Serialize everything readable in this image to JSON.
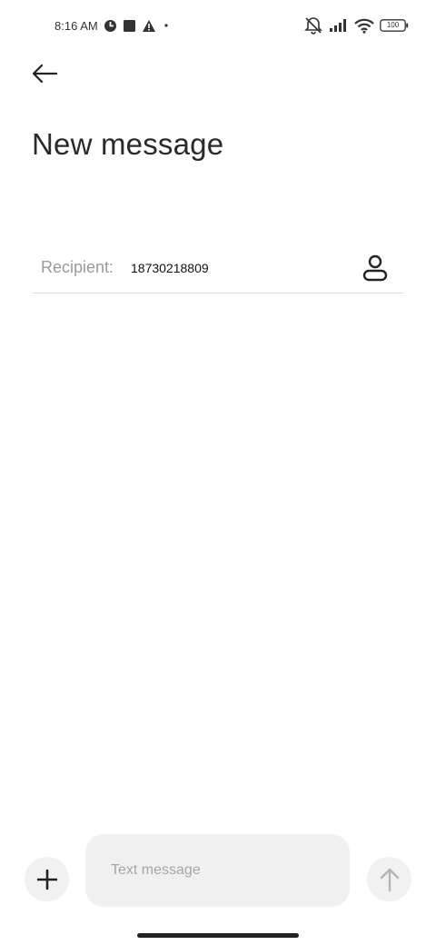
{
  "status_bar": {
    "time": "8:16 AM",
    "icons_left": [
      "clock-app-icon",
      "square-notification-icon",
      "warning-icon",
      "dot-icon"
    ],
    "icons_right": [
      "vibrate-off-icon",
      "signal-icon",
      "wifi-icon",
      "battery-icon"
    ],
    "battery": "100"
  },
  "header": {
    "back_icon": "arrow-left-icon",
    "title": "New message"
  },
  "recipient": {
    "label": "Recipient:",
    "value": "18730218809",
    "contact_icon": "contact-person-icon"
  },
  "composer": {
    "add_icon": "plus-icon",
    "placeholder": "Text message",
    "value": "",
    "send_icon": "arrow-up-icon"
  },
  "colors": {
    "background": "#ffffff",
    "input_background": "#f0f0f0",
    "divider": "#dddddd",
    "label_gray": "#9a9a9a"
  }
}
